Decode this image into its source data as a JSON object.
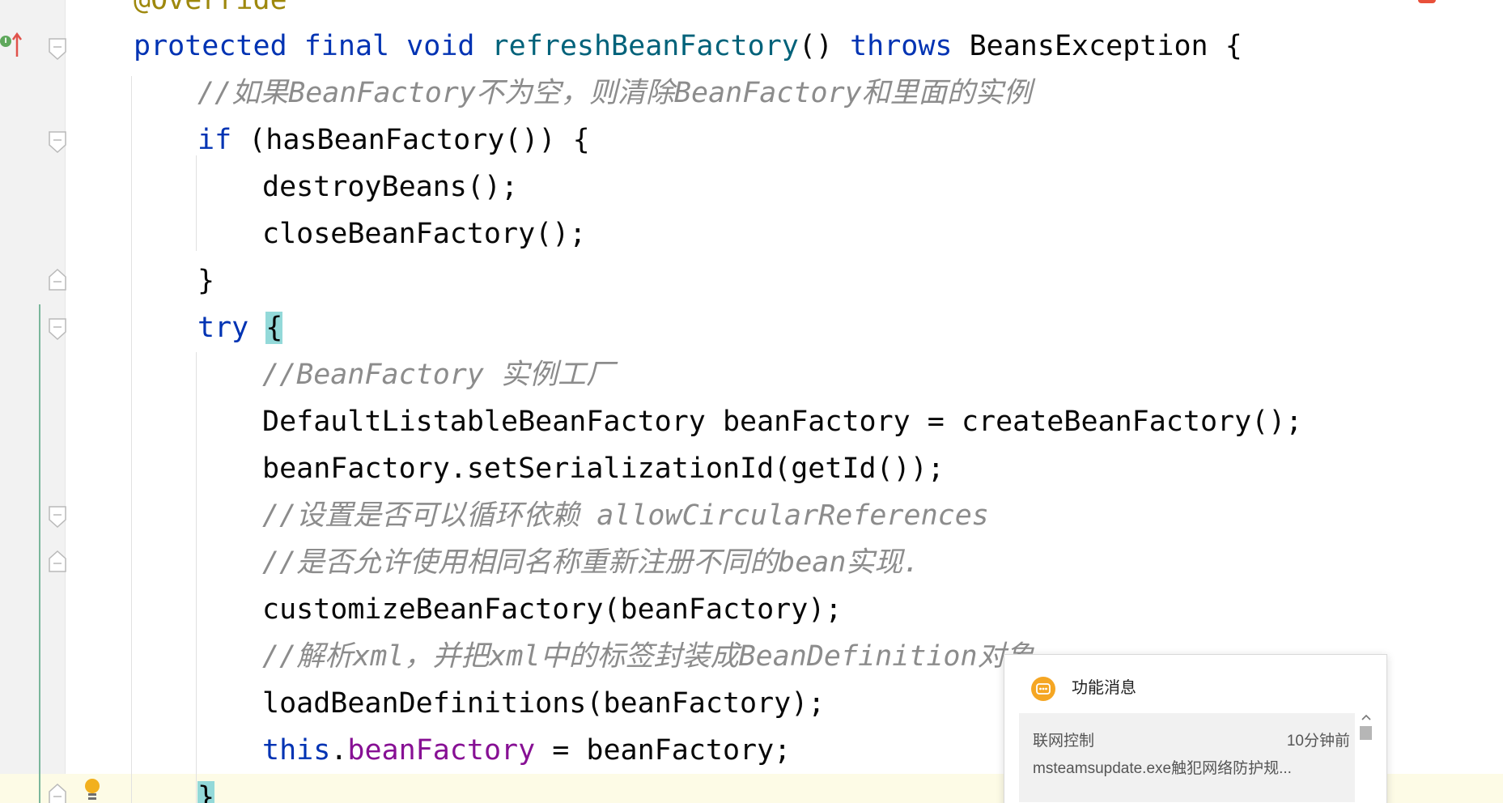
{
  "editor": {
    "language": "Java",
    "code": {
      "override_annotation": "@Override",
      "method_signature": {
        "protected_kw": "protected",
        "final_kw": "final",
        "void_kw": "void",
        "method_name": "refreshBeanFactory",
        "parens": "()",
        "throws_kw": "throws",
        "exception_type": "BeansException",
        "open_brace": "{"
      },
      "comment_destroy": "//如果BeanFactory不为空，则清除BeanFactory和里面的实例",
      "if_kw": "if",
      "if_condition": " (hasBeanFactory()) {",
      "destroy_call": "destroyBeans();",
      "close_call": "closeBeanFactory();",
      "if_close": "}",
      "try_kw": "try",
      "try_brace": "{",
      "comment_factory": "//BeanFactory 实例工厂",
      "create_line": "DefaultListableBeanFactory beanFactory = createBeanFactory();",
      "serialization_line": "beanFactory.setSerializationId(getId());",
      "comment_circular": "//设置是否可以循环依赖 allowCircularReferences",
      "comment_override": "//是否允许使用相同名称重新注册不同的bean实现.",
      "customize_line": "customizeBeanFactory(beanFactory);",
      "comment_parse": "//解析xml，并把xml中的标签封装成BeanDefinition对象",
      "load_line": "loadBeanDefinitions(beanFactory);",
      "this_kw": "this",
      "dot": ".",
      "field_name": "beanFactory",
      "assign_rest": " = beanFactory;",
      "try_close": "}"
    }
  },
  "notification": {
    "title": "功能消息",
    "source": "联网控制",
    "time": "10分钟前",
    "message": "msteamsupdate.exe触犯网络防护规..."
  },
  "gutter": {
    "implements_badge": "I"
  },
  "colors": {
    "keyword": "#0033b3",
    "method_declaration": "#00627a",
    "comment": "#8c8c8c",
    "field": "#871094",
    "annotation": "#9e880d",
    "brace_highlight": "#93d9d9",
    "notification_icon": "#f5a623"
  },
  "icons": [
    "implements-icon",
    "override-arrow-icon",
    "fold-marker-icon",
    "intention-bulb-icon",
    "message-icon",
    "chevron-up-icon"
  ]
}
